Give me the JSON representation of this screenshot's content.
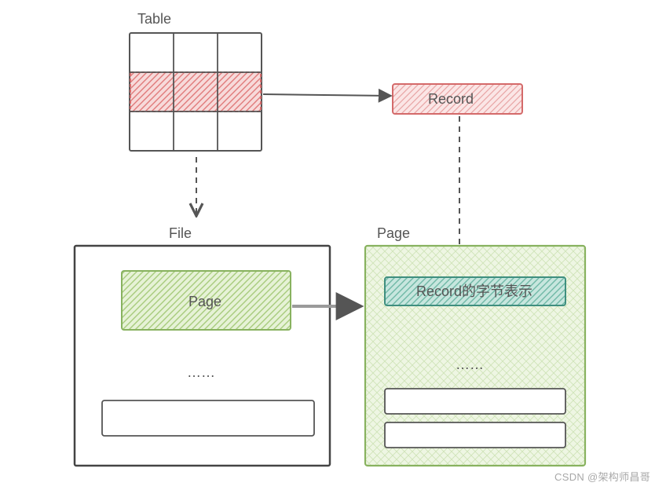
{
  "labels": {
    "table": "Table",
    "record": "Record",
    "file": "File",
    "page_left": "Page",
    "page_right_title": "Page",
    "record_bytes": "Record的字节表示",
    "ellipsis_left": "……",
    "ellipsis_right": "……"
  },
  "watermark": "CSDN @架构师昌哥",
  "colors": {
    "stroke": "#555555",
    "red_fill": "#f7a8a8",
    "red_stroke": "#d46a6a",
    "green_fill": "#b6d98e",
    "green_stroke": "#88b25f",
    "teal_fill": "#8ecfbf",
    "teal_stroke": "#3f8f7f",
    "page_bg": "#e6f2d6"
  }
}
